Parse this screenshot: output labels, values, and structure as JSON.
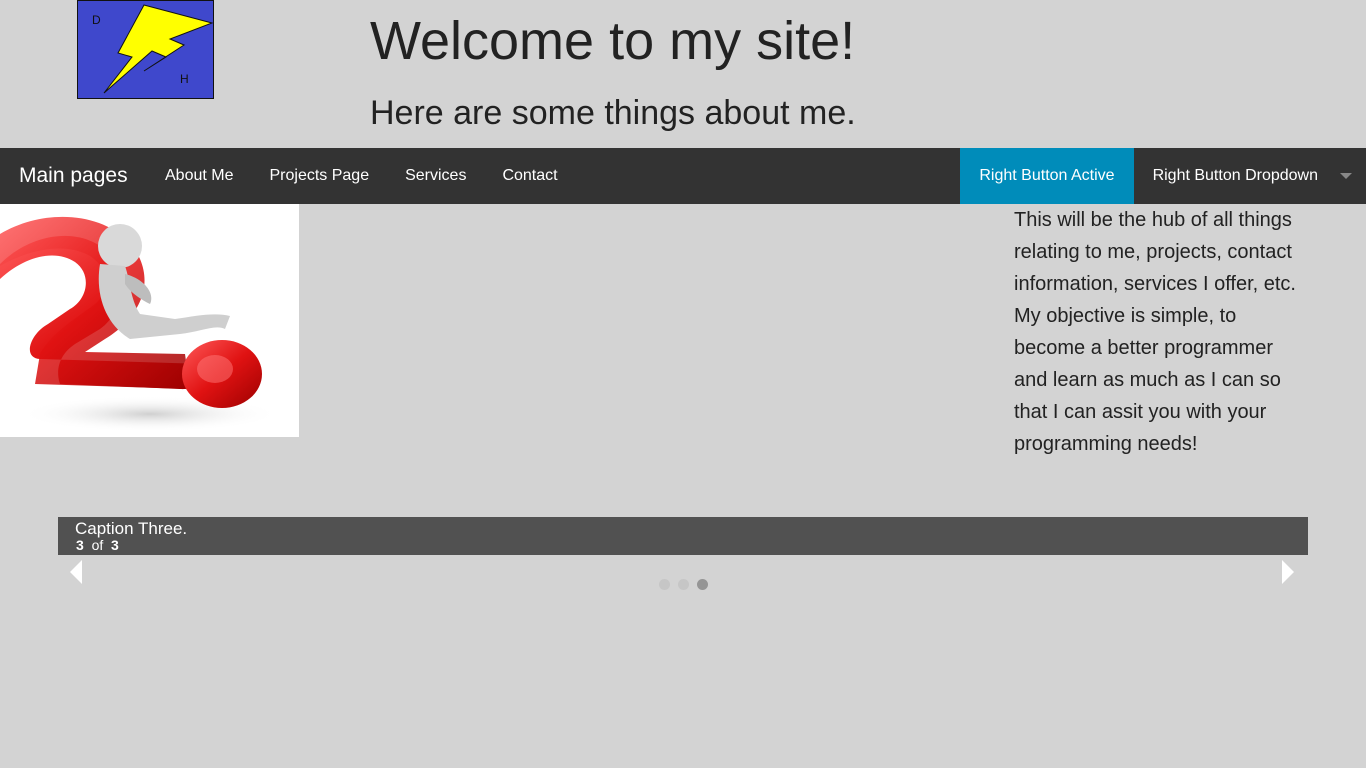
{
  "header": {
    "logo": {
      "letter_top": "D",
      "letter_bottom": "H",
      "background_color": "#3f48cc",
      "bolt_color": "#ffff00"
    },
    "title": "Welcome to my site!",
    "subtitle": "Here are some things about me."
  },
  "topbar": {
    "brand": "Main pages",
    "left_items": [
      {
        "label": "About Me"
      },
      {
        "label": "Projects Page"
      },
      {
        "label": "Services"
      },
      {
        "label": "Contact"
      }
    ],
    "right_active_label": "Right Button Active",
    "right_dropdown_label": "Right Button Dropdown",
    "active_color": "#008cba"
  },
  "about": {
    "text": "This will be the hub of all things relating to me, projects, contact information, services I offer, etc. My objective is simple, to become a better programmer and learn as much as I can so that I can assit you with your programming needs!"
  },
  "slider": {
    "caption": "Caption Three.",
    "current": "3",
    "of_label": "of",
    "total": "3",
    "bullets": [
      {
        "active": false
      },
      {
        "active": false
      },
      {
        "active": true
      }
    ]
  }
}
